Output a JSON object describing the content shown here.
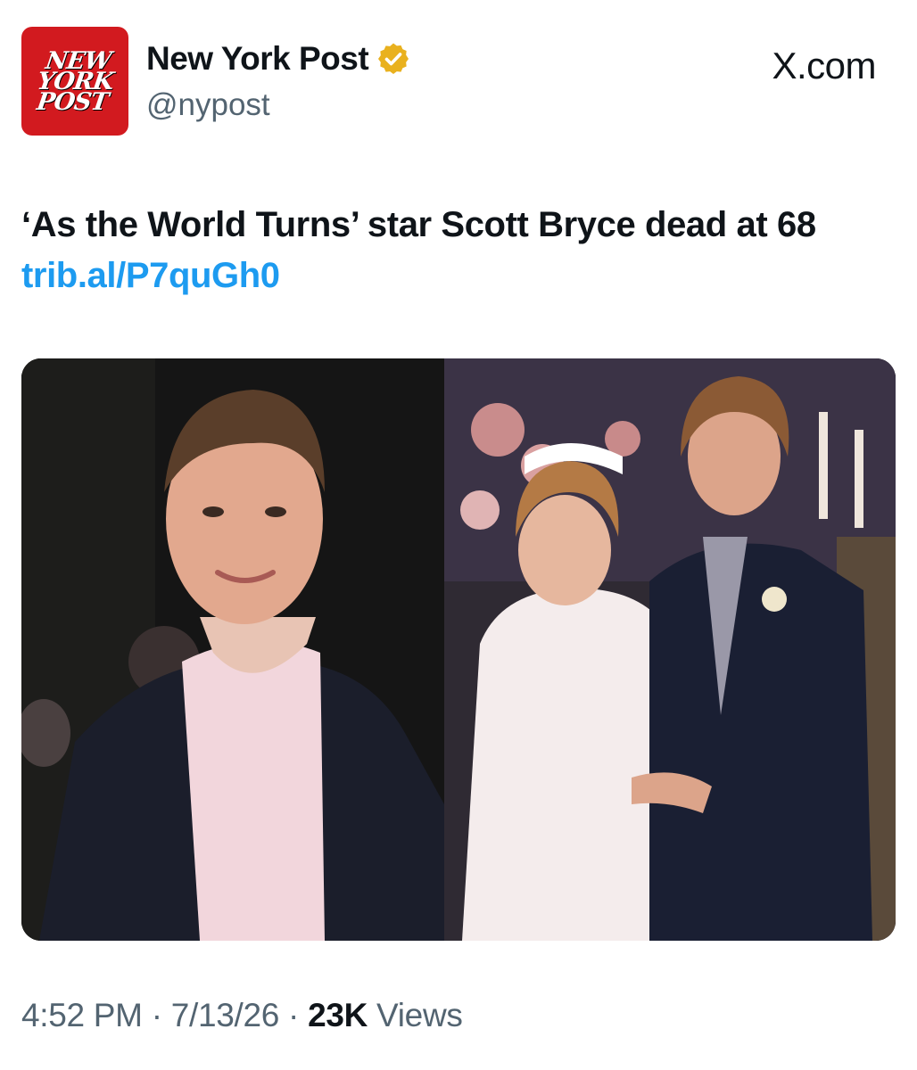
{
  "account": {
    "avatar_text": [
      "NEW",
      "YORK",
      "POST"
    ],
    "display_name": "New York Post",
    "handle": "@nypost",
    "verified_icon": "verified-badge-gold",
    "brand_color": "#d21a1f"
  },
  "site_label": "X.com",
  "tweet": {
    "text": "‘As the World Turns’ star Scott Bryce dead at 68",
    "link": "trib.al/P7quGh0",
    "link_color": "#1d9bf0"
  },
  "media": {
    "photos": [
      {
        "name": "photo-scott-bryce-portrait"
      },
      {
        "name": "photo-wedding-scene"
      }
    ]
  },
  "meta": {
    "time": "4:52 PM",
    "date": "7/13/26",
    "views_count": "23K",
    "views_label": "Views",
    "separator": "·"
  }
}
